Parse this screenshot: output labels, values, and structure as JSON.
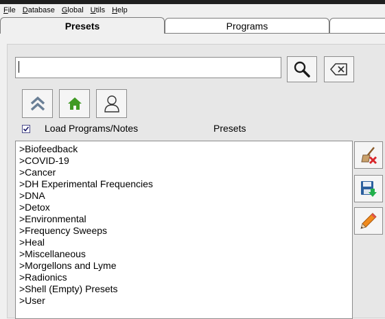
{
  "menu": {
    "items": [
      {
        "key": "F",
        "rest": "ile"
      },
      {
        "key": "D",
        "rest": "atabase"
      },
      {
        "key": "G",
        "rest": "lobal"
      },
      {
        "key": "U",
        "rest": "tils"
      },
      {
        "key": "H",
        "rest": "elp"
      }
    ]
  },
  "tabs": {
    "presets": "Presets",
    "programs": "Programs"
  },
  "search": {
    "value": "",
    "placeholder": ""
  },
  "options": {
    "load_programs_notes_label": "Load Programs/Notes",
    "load_programs_notes_checked": true,
    "section_label": "Presets"
  },
  "presets_list": [
    ">Biofeedback",
    ">COVID-19",
    ">Cancer",
    ">DH Experimental Frequencies",
    ">DNA",
    ">Detox",
    ">Environmental",
    ">Frequency Sweeps",
    ">Heal",
    ">Miscellaneous",
    ">Morgellons and Lyme",
    ">Radionics",
    ">Shell (Empty) Presets",
    ">User"
  ],
  "icons": {
    "search": "magnifier-icon",
    "clear": "backspace-icon",
    "up": "double-chevron-up-icon",
    "home": "home-icon",
    "user": "user-icon",
    "delete": "broom-delete-icon",
    "save": "save-disk-icon",
    "edit": "pencil-icon"
  },
  "colors": {
    "home_green": "#3f9a24",
    "chevron_blue": "#6a7f96",
    "delete_red": "#d8272b",
    "save_green": "#22b04b",
    "pencil_orange": "#f08a1c"
  }
}
